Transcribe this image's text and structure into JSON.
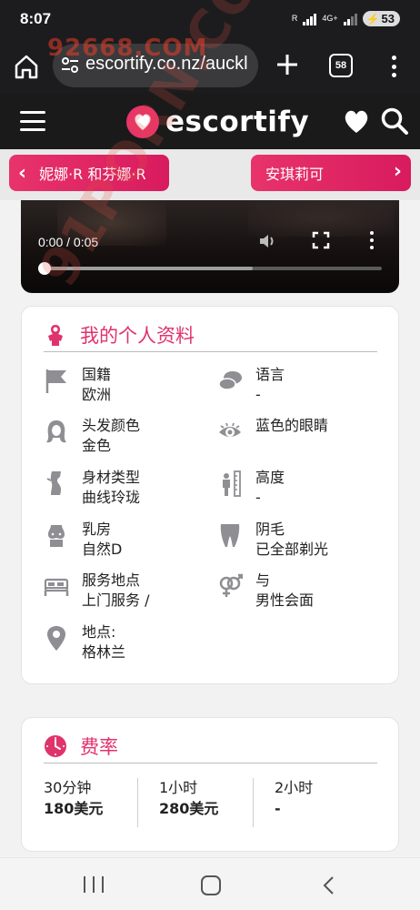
{
  "status_bar": {
    "time": "8:07",
    "carrier_small": "R",
    "network": "4G+",
    "battery": "53"
  },
  "browser": {
    "url": "escortify.co.nz/auckl",
    "tab_count": "58"
  },
  "site": {
    "logo_text": "escortify",
    "accent_color": "#e0336c"
  },
  "nav": {
    "prev_label": "妮娜·R 和芬娜·R",
    "next_label": "安琪莉可"
  },
  "video": {
    "time": "0:00 / 0:05",
    "buffered_fraction": 0.62,
    "played_fraction": 0.0
  },
  "profile": {
    "title": "我的个人资料",
    "attributes": [
      {
        "icon": "flag-icon",
        "label": "国籍",
        "value": "欧洲"
      },
      {
        "icon": "speech-bubbles-icon",
        "label": "语言",
        "value": "-"
      },
      {
        "icon": "hair-icon",
        "label": "头发颜色",
        "value": "金色"
      },
      {
        "icon": "eye-icon",
        "label": "蓝色的眼睛",
        "value": ""
      },
      {
        "icon": "body-type-icon",
        "label": "身材类型",
        "value": "曲线玲珑"
      },
      {
        "icon": "height-icon",
        "label": "高度",
        "value": "-"
      },
      {
        "icon": "bust-icon",
        "label": "乳房",
        "value": "自然D"
      },
      {
        "icon": "pubic-icon",
        "label": "阴毛",
        "value": "已全部剃光"
      },
      {
        "icon": "bed-icon",
        "label": "服务地点",
        "value": "上门服务 /"
      },
      {
        "icon": "gender-icon",
        "label": "与",
        "value": "男性会面"
      },
      {
        "icon": "location-pin-icon",
        "label": "地点:",
        "value": "格林兰"
      }
    ]
  },
  "rates": {
    "title": "费率",
    "items": [
      {
        "label": "30分钟",
        "value": "180美元"
      },
      {
        "label": "1小时",
        "value": "280美元"
      },
      {
        "label": "2小时",
        "value": "-"
      }
    ]
  },
  "watermark": {
    "top": "92668.COM",
    "diagonal": "91PORN.COM"
  }
}
